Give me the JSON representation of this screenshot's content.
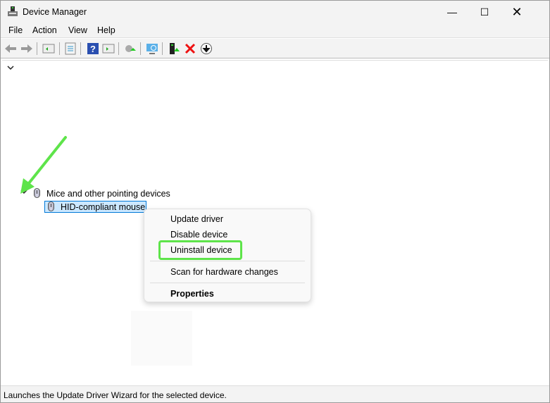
{
  "window": {
    "title": "Device Manager"
  },
  "menu": [
    "File",
    "Action",
    "View",
    "Help"
  ],
  "toolbar": [
    "back",
    "forward",
    "show-hide-console-tree",
    "properties",
    "help",
    "show-action-pane",
    "update-driver",
    "scan-hardware",
    "enable-device",
    "uninstall-device",
    "disable-device"
  ],
  "tree": {
    "category": "Mice and other pointing devices",
    "device": "HID-compliant mouse"
  },
  "context_menu": {
    "update": "Update driver",
    "disable": "Disable device",
    "uninstall": "Uninstall device",
    "scan": "Scan for hardware changes",
    "properties": "Properties"
  },
  "status": "Launches the Update Driver Wizard for the selected device.",
  "colors": {
    "highlight": "#5ee44a",
    "selection": "#cce8ff"
  }
}
